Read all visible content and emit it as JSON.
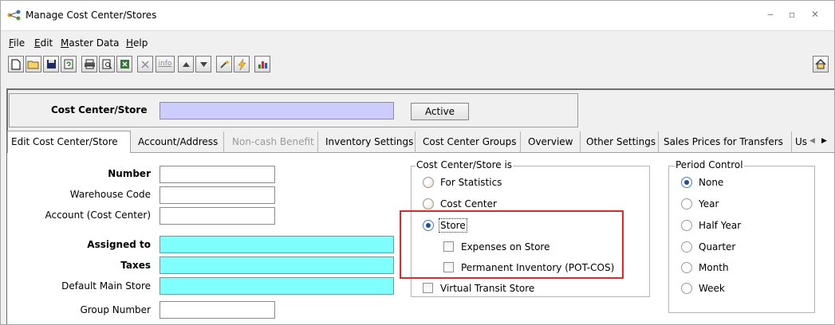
{
  "window": {
    "title": "Manage Cost Center/Stores",
    "controls": [
      "_",
      "▢",
      "⤡"
    ]
  },
  "menu": {
    "items": [
      {
        "label": "File",
        "ul": "F",
        "rest": "ile"
      },
      {
        "label": "Edit",
        "ul": "E",
        "rest": "dit"
      },
      {
        "label": "Master Data",
        "ul": "M",
        "rest": "aster Data"
      },
      {
        "label": "Help",
        "ul": "H",
        "rest": "elp"
      }
    ]
  },
  "toolbar": {
    "icons": [
      "new-document-icon",
      "open-folder-icon",
      "save-icon",
      "refresh-icon",
      "print-icon",
      "print-preview-icon",
      "excel-export-icon",
      "delete-icon",
      "info-icon",
      "move-up-icon",
      "move-down-icon",
      "magic-wand-icon",
      "lightning-icon",
      "bar-chart-icon",
      "home-icon"
    ],
    "info_text": "info"
  },
  "header": {
    "label": "Cost Center/Store",
    "value": "",
    "active_button": "Active",
    "field_color": "#ccccff"
  },
  "tabs": [
    {
      "label": "Edit Cost Center/Store",
      "state": "active"
    },
    {
      "label": "Account/Address",
      "state": "normal"
    },
    {
      "label": "Non-cash Benefit",
      "state": "disabled"
    },
    {
      "label": "Inventory Settings",
      "state": "normal"
    },
    {
      "label": "Cost Center Groups",
      "state": "normal"
    },
    {
      "label": "Overview",
      "state": "normal"
    },
    {
      "label": "Other Settings",
      "state": "normal"
    },
    {
      "label": "Sales Prices for Transfers",
      "state": "normal"
    },
    {
      "label": "Us",
      "state": "normal"
    }
  ],
  "form": {
    "number": {
      "label": "Number",
      "value": ""
    },
    "warehouse_code": {
      "label": "Warehouse Code",
      "value": ""
    },
    "account": {
      "label": "Account (Cost Center)",
      "value": ""
    },
    "assigned_to": {
      "label": "Assigned to",
      "value": ""
    },
    "taxes": {
      "label": "Taxes",
      "value": ""
    },
    "default_main_store": {
      "label": "Default Main Store",
      "value": ""
    },
    "group_number": {
      "label": "Group Number",
      "value": ""
    },
    "lookup_color": "#80ffff"
  },
  "cost_center_group": {
    "title": "Cost Center/Store is",
    "options": [
      {
        "label": "For Statistics",
        "checked": false
      },
      {
        "label": "Cost Center",
        "checked": false
      },
      {
        "label": "Store",
        "checked": true
      }
    ],
    "store_checks": [
      {
        "label": "Expenses on Store",
        "checked": false
      },
      {
        "label": "Permanent Inventory (POT-COS)",
        "checked": false
      }
    ],
    "virtual_transit": {
      "label": "Virtual Transit Store",
      "checked": false
    }
  },
  "period_control": {
    "title": "Period Control",
    "options": [
      {
        "label": "None",
        "checked": true
      },
      {
        "label": "Year",
        "checked": false
      },
      {
        "label": "Half Year",
        "checked": false
      },
      {
        "label": "Quarter",
        "checked": false
      },
      {
        "label": "Month",
        "checked": false
      },
      {
        "label": "Week",
        "checked": false
      }
    ]
  },
  "colors": {
    "highlight": "#e0282a"
  }
}
